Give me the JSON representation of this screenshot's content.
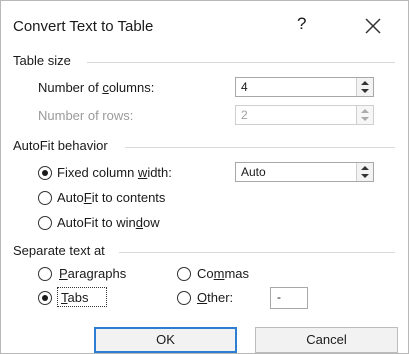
{
  "dialog": {
    "title": "Convert Text to Table",
    "help_glyph": "?",
    "close_glyph": "✕"
  },
  "table_size": {
    "label": "Table size",
    "columns": {
      "label_pre": "Number of ",
      "label_u": "c",
      "label_post": "olumns:",
      "value": "4"
    },
    "rows": {
      "label": "Number of rows:",
      "value": "2",
      "disabled": true
    }
  },
  "autofit": {
    "label": "AutoFit behavior",
    "fixed": {
      "label_pre": "Fixed column ",
      "label_u": "w",
      "label_post": "idth:",
      "value": "Auto",
      "checked": true
    },
    "contents": {
      "label_pre": "Auto",
      "label_u": "F",
      "label_post": "it to contents",
      "checked": false
    },
    "window": {
      "label_pre": "AutoFit to win",
      "label_u": "d",
      "label_post": "ow",
      "checked": false
    }
  },
  "separate": {
    "label": "Separate text at",
    "paragraphs": {
      "label_u": "P",
      "label_post": "aragraphs",
      "checked": false
    },
    "commas": {
      "label_pre": "Co",
      "label_u": "m",
      "label_post": "mas",
      "checked": false
    },
    "tabs": {
      "label_u": "T",
      "label_post": "abs",
      "checked": true
    },
    "other": {
      "label_u": "O",
      "label_post": "ther:",
      "value": "-",
      "checked": false
    }
  },
  "buttons": {
    "ok": "OK",
    "cancel": "Cancel"
  }
}
